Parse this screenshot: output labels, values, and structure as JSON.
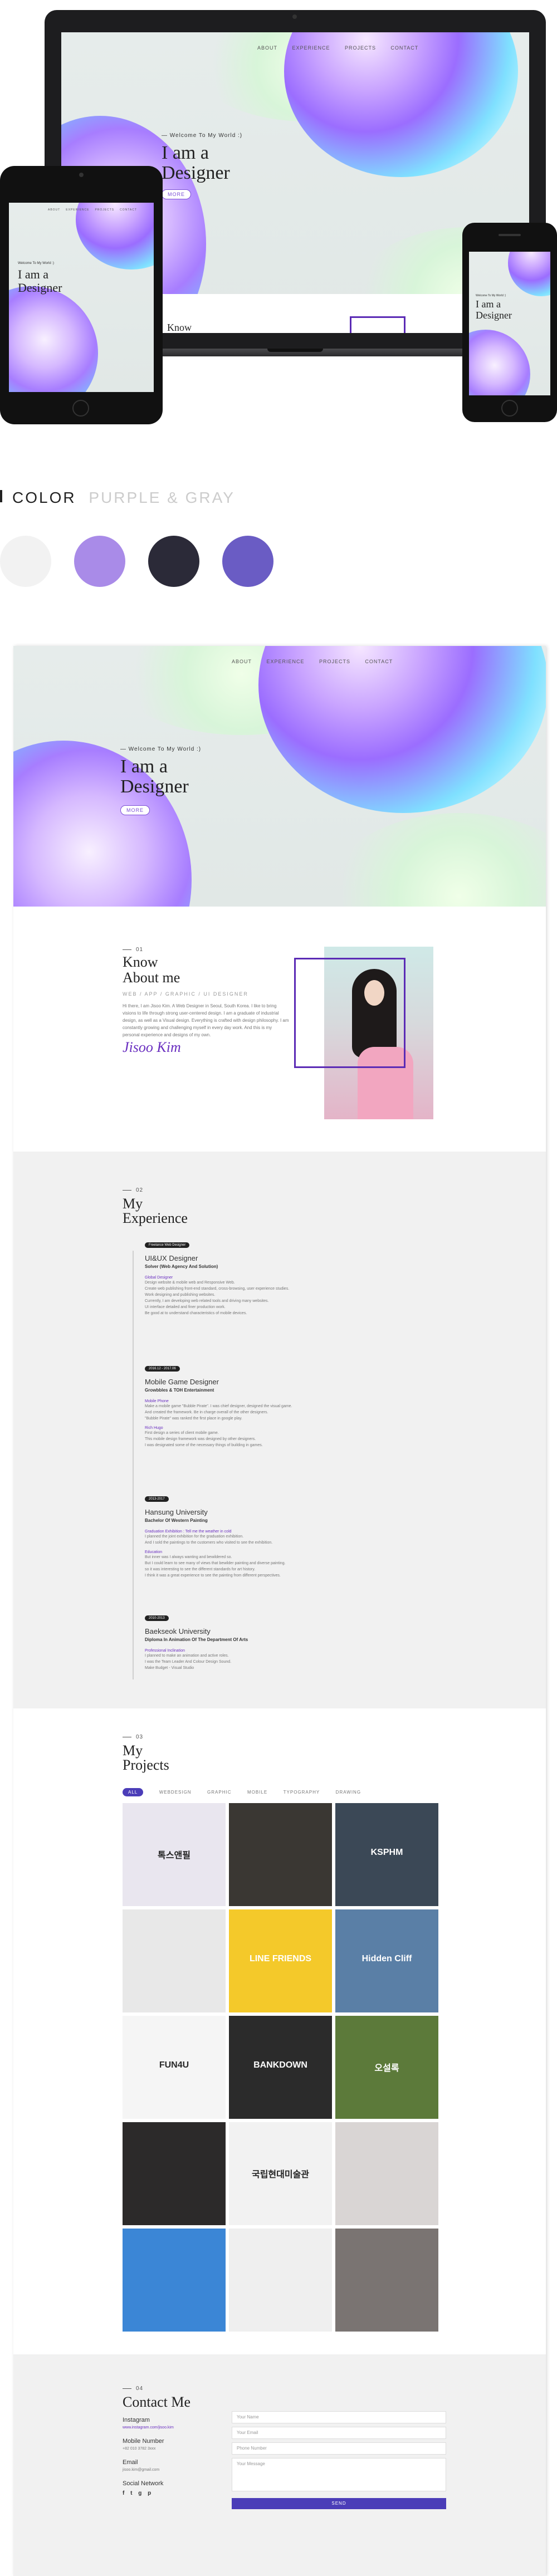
{
  "mockup": {
    "nav": [
      "ABOUT",
      "EXPERIENCE",
      "PROJECTS",
      "CONTACT"
    ],
    "welcome": "Welcome To My World :)",
    "headline1": "I am a",
    "headline2": "Designer",
    "more_btn": "MORE",
    "laptop_partial": "Know"
  },
  "colors_section": {
    "label_a": "COLOR",
    "label_b": "PURPLE & GRAY",
    "swatches": [
      "#f2f2f2",
      "#a98be8",
      "#2b2a38",
      "#6a5cc4"
    ]
  },
  "site": {
    "nav": [
      "ABOUT",
      "EXPERIENCE",
      "PROJECTS",
      "CONTACT"
    ],
    "welcome": "Welcome To My World :)",
    "headline1": "I am a",
    "headline2": "Designer",
    "more_btn": "MORE",
    "about": {
      "num": "01",
      "title1": "Know",
      "title2": "About me",
      "tagline": "WEB / APP / GRAPHIC / UI DESIGNER",
      "body": "Hi there, I am Jisoo Kim. A Web Designer in Seoul, South Korea. I like to bring visions to life through strong user-centered design. I am a graduate of industrial design, as well as a Visual design. Everything is crafted with design philosophy. I am constantly growing and challenging myself in every day work. And this is my personal experience and designs of my own.",
      "signature": "Jisoo Kim"
    },
    "experience": {
      "num": "02",
      "title1": "My",
      "title2": "Experience",
      "items": [
        {
          "badge": "Freelance Web Designer",
          "title": "UI&UX Designer",
          "sub": "Solver (Web Agency And Solution)",
          "role": "Global Designer",
          "lines": [
            "Design website & mobile web and Responsive Web.",
            "Create web publishing front-end standard, cross-browsing, user experience studies.",
            "Work designing and publishing websites.",
            "Currently, I am developing web related tools and driving many websites.",
            "UI interface detailed and finer production work.",
            "Be good at to understand characteristics of mobile devices."
          ]
        },
        {
          "badge": "2016.12 - 2017.06",
          "title": "Mobile Game Designer",
          "sub": "Growbbles & TOH Entertainment",
          "role": "Mobile Phone",
          "lines": [
            "Make a mobile game \"Bubble Pirate\". I was chief designer, designed the visual game.",
            "And created the framework. Be in charge overall of the other designers.",
            "\"Bubble Pirate\" was ranked the first place in google play.",
            "Rich Hugo",
            "First design a series of client mobile game.",
            "This mobile design framework was designed by other designers.",
            "I was designated some of the necessary things of building in games."
          ]
        },
        {
          "badge": "2013-2017",
          "title": "Hansung University",
          "sub": "Bachelor Of Western Painting",
          "role": "Graduation Exhibition : Tell me the weather in cold",
          "lines": [
            "I planned the joint exhibition for the graduation exhibition.",
            "And I sold the paintings to the customers who visited to see the exhibition.",
            "Education",
            "But inner was I always wanting and bewildered so.",
            "But I could learn to see many of views that bewilder painting and diverse painting.",
            "so it was interesting to see the different standards for art history.",
            "I think it was a great experience to see the painting from different perspectives."
          ]
        },
        {
          "badge": "2010-2013",
          "title": "Baekseok University",
          "sub": "Diploma In Animation Of The Department Of Arts",
          "role": "Professional Inclination",
          "lines": [
            "I planned to make an animation and active roles.",
            "I was the Team Leader And Colour Design Sound.",
            "Make Budget - Visual Studio"
          ]
        }
      ]
    },
    "projects": {
      "num": "03",
      "title1": "My",
      "title2": "Projects",
      "filters": [
        "ALL",
        "WEBDESIGN",
        "GRAPHIC",
        "MOBILE",
        "TYPOGRAPHY",
        "DRAWING"
      ],
      "tiles": [
        {
          "label": "톡스앤필",
          "bg": "#e9e6ef",
          "fg": "#222"
        },
        {
          "label": "",
          "bg": "#3a3733",
          "fg": "#fff"
        },
        {
          "label": "KSPHM",
          "bg": "#3b4856",
          "fg": "#fff"
        },
        {
          "label": "",
          "bg": "#e8e8e8",
          "fg": "#222"
        },
        {
          "label": "LINE FRIENDS",
          "bg": "#f4c92a",
          "fg": "#fff"
        },
        {
          "label": "Hidden Cliff",
          "bg": "#5a7fa6",
          "fg": "#fff"
        },
        {
          "label": "FUN4U",
          "bg": "#f5f5f5",
          "fg": "#2a2a2a"
        },
        {
          "label": "BANKDOWN",
          "bg": "#2b2b2b",
          "fg": "#fff"
        },
        {
          "label": "오설록",
          "bg": "#5c7a3a",
          "fg": "#fff"
        },
        {
          "label": "",
          "bg": "#2c2a2a",
          "fg": "#fff"
        },
        {
          "label": "국립현대미술관",
          "bg": "#f2f2f2",
          "fg": "#222"
        },
        {
          "label": "",
          "bg": "#d9d5d4",
          "fg": "#222"
        },
        {
          "label": "",
          "bg": "#3b86d6",
          "fg": "#fff"
        },
        {
          "label": "",
          "bg": "#efefef",
          "fg": "#222"
        },
        {
          "label": "",
          "bg": "#7a7472",
          "fg": "#fff"
        }
      ]
    },
    "contact": {
      "num": "04",
      "title": "Contact Me",
      "instagram_label": "Instagram",
      "instagram_value": "www.instagram.com/jisoo.kim",
      "mobile_label": "Mobile Number",
      "mobile_value": "+82 010 3782 3xxx",
      "email_label": "Email",
      "email_value": "jisoo.kim@gmail.com",
      "social_label": "Social Network",
      "social_icons": [
        "f",
        "t",
        "g",
        "p"
      ],
      "fields": [
        "Your Name",
        "Your Email",
        "Phone Number",
        "Your Message"
      ],
      "send_btn": "SEND"
    }
  }
}
